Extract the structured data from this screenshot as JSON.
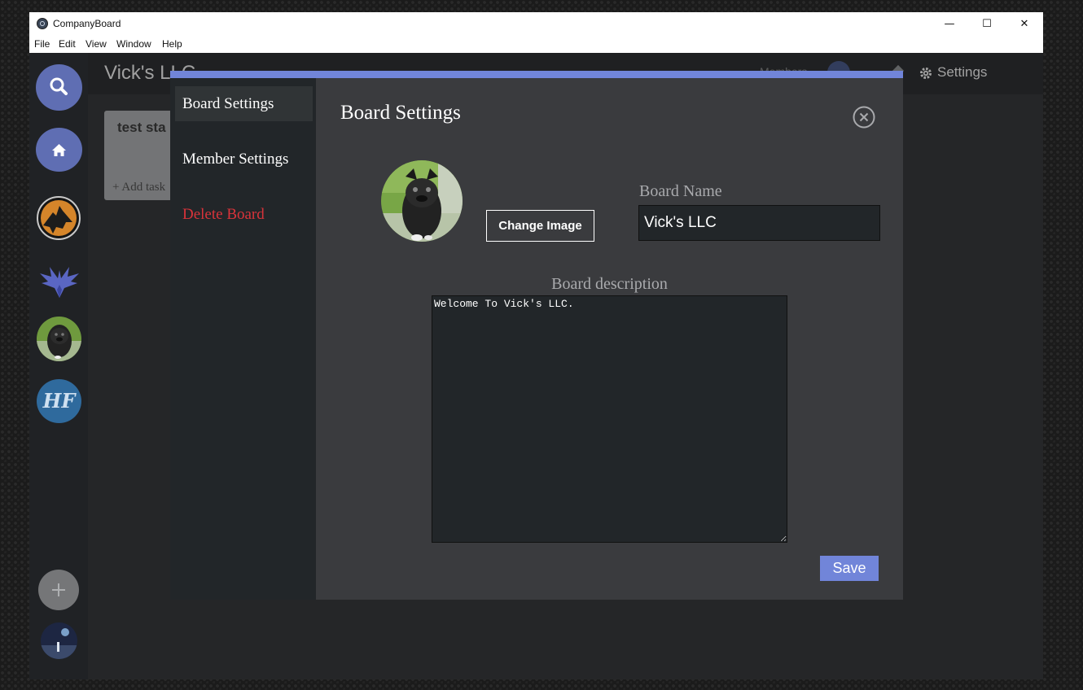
{
  "window": {
    "title": "CompanyBoard",
    "controls": {
      "minimize": "—",
      "maximize": "☐",
      "close": "✕"
    }
  },
  "menu": [
    "File",
    "Edit",
    "View",
    "Window",
    "Help"
  ],
  "header": {
    "board_title": "Vick's LLC ⌄",
    "members_label": "Members",
    "settings_label": "Settings"
  },
  "board": {
    "card_title": "test sta",
    "add_task_label": "+ Add task"
  },
  "sidebar": {
    "icons": [
      "search-icon",
      "home-icon",
      "wolf-logo",
      "phoenix-logo",
      "pug-avatar",
      "hf-logo",
      "add-icon",
      "user-avatar"
    ],
    "hf_text": "HF",
    "add_symbol": "+"
  },
  "modal": {
    "nav": {
      "board_settings": "Board Settings",
      "member_settings": "Member Settings",
      "delete_board": "Delete Board"
    },
    "title": "Board Settings",
    "change_image_label": "Change Image",
    "board_name_label": "Board Name",
    "board_name_value": "Vick's LLC",
    "description_label": "Board description",
    "description_value": "Welcome To Vick's LLC.",
    "save_label": "Save"
  },
  "colors": {
    "accent": "#7185d9",
    "danger": "#d8333a",
    "nav_bg": "#222629",
    "modal_bg": "#3a3b3e"
  }
}
